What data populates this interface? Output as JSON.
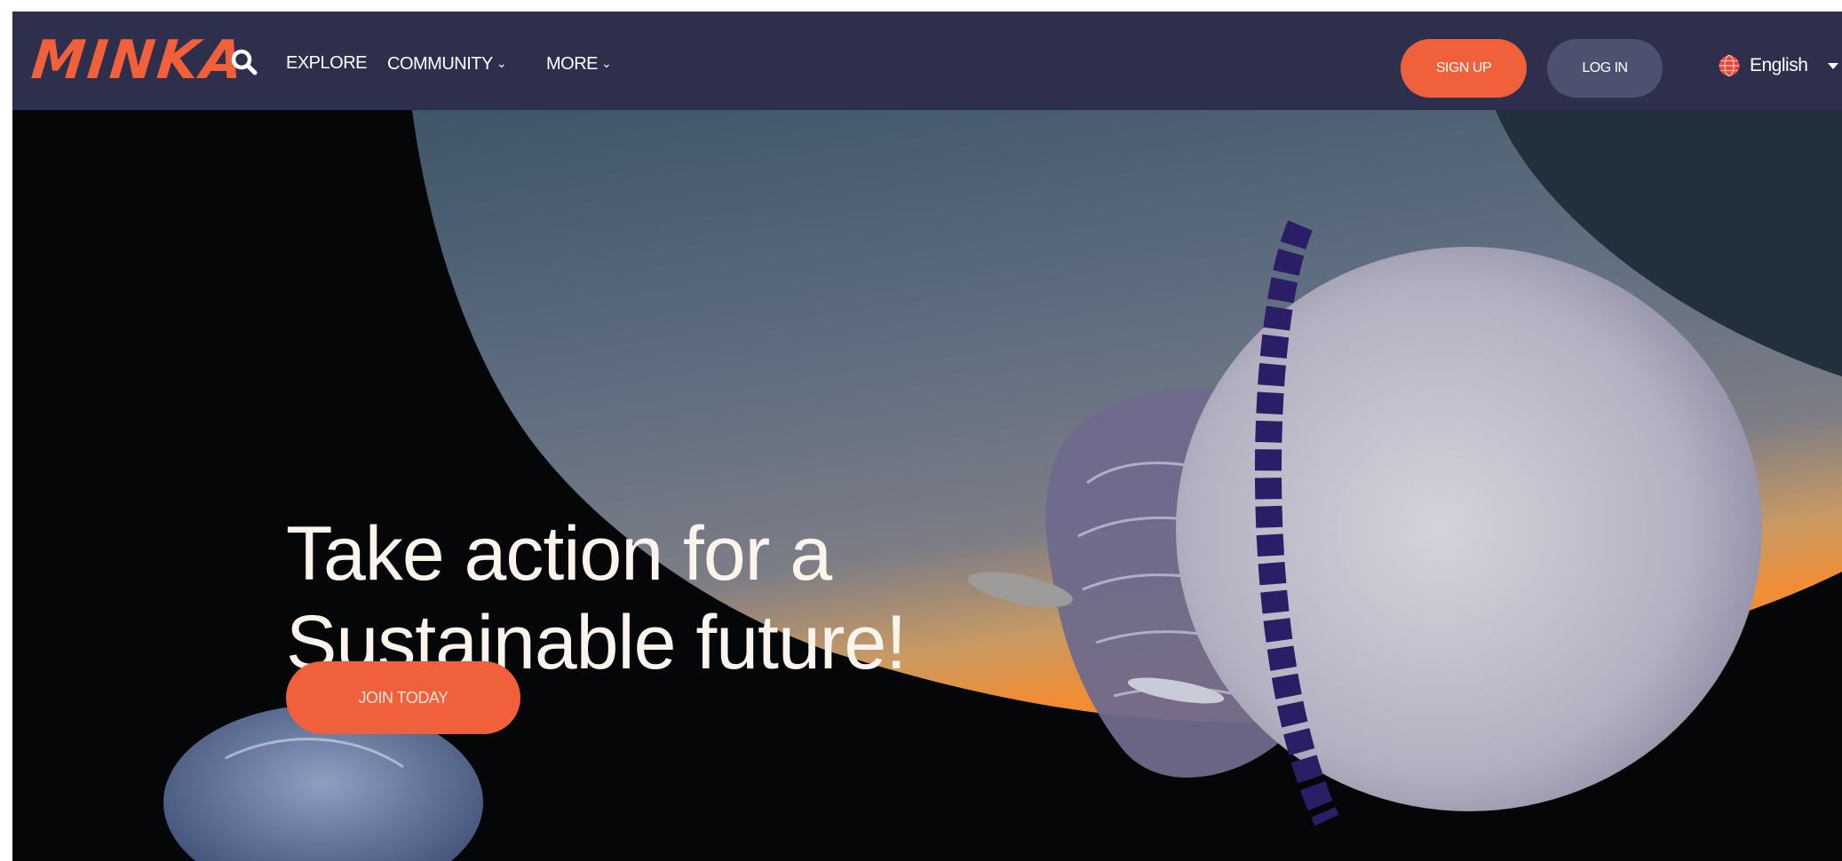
{
  "brand": {
    "logo_text": "MINKA",
    "accent_color": "#f0603a",
    "nav_bg": "#2e2f4d"
  },
  "nav": {
    "search_icon": "search-icon",
    "links": [
      {
        "label": "EXPLORE",
        "dropdown": false
      },
      {
        "label": "COMMUNITY",
        "dropdown": true
      },
      {
        "label": "MORE",
        "dropdown": true
      }
    ]
  },
  "auth": {
    "signup_label": "SIGN UP",
    "login_label": "LOG IN"
  },
  "language": {
    "selected": "English",
    "icon": "globe-icon"
  },
  "hero": {
    "headline_line1": "Take action for a",
    "headline_line2": "Sustainable future!",
    "cta_label": "JOIN TODAY",
    "image_subject": "jellyfish"
  }
}
